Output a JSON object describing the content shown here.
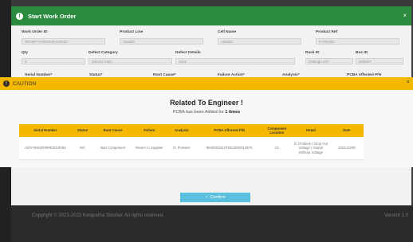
{
  "footer": {
    "copyright": "Copyright © 2021-2022 Ketapatha Stochar. All rights reserved.",
    "version": "Version 1.0"
  },
  "work_order_modal": {
    "title": "Start Work Order",
    "close": "×",
    "fields": [
      {
        "label": "Work Order ID",
        "value": "2024RTYYMK0290424022"
      },
      {
        "label": "Product Line",
        "value": "Aloadin"
      },
      {
        "label": "Cell Name",
        "value": "Aloadin"
      },
      {
        "label": "Product Ref",
        "value": "FYNR401"
      },
      {
        "label": "Qty",
        "value": "2"
      },
      {
        "label": "Defect Category",
        "value": "Electric Fails"
      },
      {
        "label": "Defect Details",
        "value": "1001"
      },
      {
        "label": "Rack ID",
        "value": "Datkage 427"
      },
      {
        "label": "Box ID",
        "value": "B28087"
      }
    ],
    "table_headers_partial": [
      "Serial Number*",
      "Status*",
      "Root Cause*",
      "Failure Action*",
      "Analysis*",
      "PCBA Affected P/N"
    ]
  },
  "caution": {
    "title": "CAUTION",
    "close": "×",
    "heading": "Related To Engineer !",
    "sub_prefix": "PCBA has been Added for",
    "sub_count": "1 times",
    "columns": [
      "Serial Number",
      "Status",
      "Root Cause",
      "Failure",
      "Analysis",
      "PCBA Affected P/N",
      "Component Location",
      "Detail",
      "Date"
    ],
    "rows": [
      [
        "ADSY9404R909R2019064",
        "NG",
        "Bad Component",
        "Return to Supplier",
        "IC Problem",
        "9840002021P2024050814976",
        "U1",
        "IC Problem | Drop Out Voltage | Output Without Voltage",
        "2024/10/09"
      ]
    ]
  },
  "confirm_button": "Confirm",
  "colors": {
    "header_green": "#2a8a3e",
    "caution_yellow": "#f5b800",
    "confirm_blue": "#5bc0de"
  }
}
